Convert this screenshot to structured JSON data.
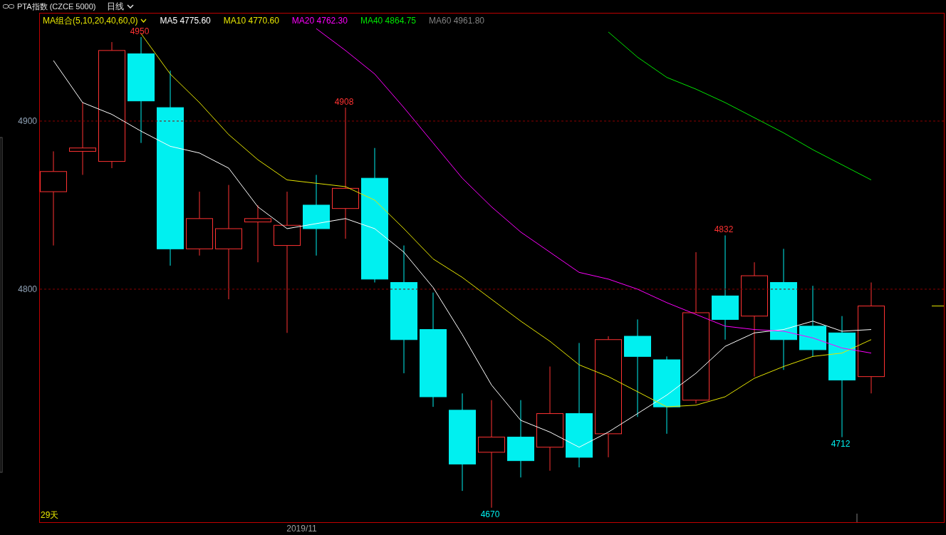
{
  "header": {
    "title": "PTA指数 (CZCE 5000)",
    "period": "日线"
  },
  "legend": {
    "group_label": "MA组合(5,10,20,40,60,0)"
  },
  "chart_data": {
    "type": "line",
    "ylim": [
      4661.4,
      4964.4
    ],
    "yticks": [
      {
        "value": 4800,
        "label": "4800"
      },
      {
        "value": 4900,
        "label": "4900"
      }
    ],
    "series": [
      {
        "name": "MA5 4775.60",
        "color": "#ffffff",
        "values": [
          4936,
          4911,
          4904,
          4894,
          4885,
          4881,
          4872,
          4849,
          4836,
          4839,
          4842,
          4836,
          4822,
          4801,
          4773,
          4743,
          4722,
          4715,
          4706,
          4715,
          4726,
          4737,
          4750,
          4766,
          4774,
          4776,
          4781,
          4775,
          4776
        ]
      },
      {
        "name": "MA10 4770.60",
        "color": "#e6e600",
        "values": [
          null,
          null,
          null,
          4952,
          4928,
          4911,
          4892,
          4877,
          4865,
          4863,
          4861,
          4853,
          4836,
          4818,
          4807,
          4794,
          4781,
          4769,
          4755,
          4748,
          4739,
          4730,
          4731,
          4736,
          4747,
          4754,
          4760,
          4762,
          4770
        ]
      },
      {
        "name": "MA20 4762.30",
        "color": "#ff00ff",
        "values": [
          null,
          null,
          null,
          null,
          null,
          null,
          null,
          null,
          null,
          4955,
          4942,
          4928,
          4908,
          4887,
          4866,
          4849,
          4834,
          4822,
          4810,
          4806,
          4800,
          4792,
          4785,
          4778,
          4776,
          4775,
          4771,
          4765,
          4762
        ]
      },
      {
        "name": "MA40 4864.75",
        "color": "#00e600",
        "values": [
          null,
          null,
          null,
          null,
          null,
          null,
          null,
          null,
          null,
          null,
          null,
          null,
          null,
          null,
          null,
          null,
          null,
          null,
          null,
          4953,
          4938,
          4926,
          4919,
          4911,
          4902,
          4893,
          4883,
          4874,
          4865
        ]
      },
      {
        "name": "MA60 4961.80",
        "color": "#808080",
        "values": [
          null,
          null,
          null,
          null,
          null,
          null,
          null,
          null,
          null,
          null,
          null,
          null,
          null,
          null,
          null,
          null,
          null,
          null,
          null,
          null,
          null,
          null,
          null,
          null,
          null,
          null,
          null,
          null,
          null
        ]
      }
    ],
    "annotations": [
      "4950",
      "4908",
      "4832",
      "4670",
      "4712",
      "2019/11"
    ]
  },
  "day_count": "29天"
}
